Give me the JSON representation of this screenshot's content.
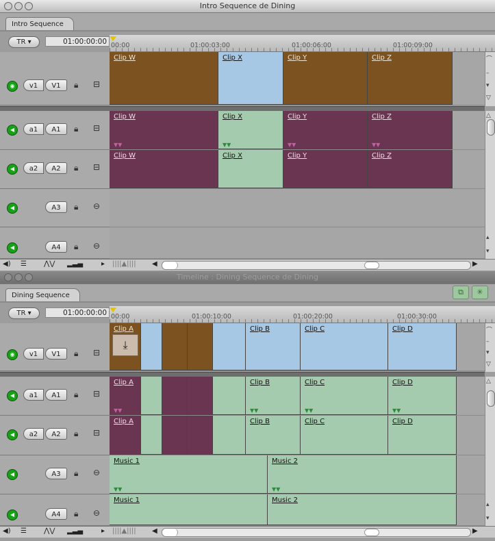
{
  "windows": [
    {
      "title": "Intro Sequence de Dining",
      "tab": "Intro Sequence",
      "track_button": "TR",
      "timecode": "01:00:00:00",
      "ruler_marks": [
        "00:00",
        "01:00:03:00",
        "01:00:06:00",
        "01:00:09:00"
      ],
      "tracks": {
        "v1": {
          "src": "v1",
          "dst": "V1",
          "clips": [
            "Clip W",
            "Clip X",
            "Clip Y",
            "Clip Z"
          ]
        },
        "a1": {
          "src": "a1",
          "dst": "A1",
          "clips": [
            "Clip W",
            "Clip X",
            "Clip Y",
            "Clip Z"
          ]
        },
        "a2": {
          "src": "a2",
          "dst": "A2",
          "clips": [
            "Clip W",
            "Clip X",
            "Clip Y",
            "Clip Z"
          ]
        },
        "a3": {
          "dst": "A3"
        },
        "a4": {
          "dst": "A4"
        }
      }
    },
    {
      "title": "Timeline : Dining Sequence de Dining",
      "tab": "Dining Sequence",
      "track_button": "TR",
      "timecode": "01:00:00:00",
      "ruler_marks": [
        "00:00",
        "01:00:10:00",
        "01:00:20:00",
        "01:00:30:00"
      ],
      "tracks": {
        "v1": {
          "src": "v1",
          "dst": "V1",
          "clips": [
            "Clip A",
            "Clip B",
            "Clip C",
            "Clip D"
          ]
        },
        "a1": {
          "src": "a1",
          "dst": "A1",
          "clips": [
            "Clip A",
            "Clip B",
            "Clip C",
            "Clip D"
          ]
        },
        "a2": {
          "src": "a2",
          "dst": "A2",
          "clips": [
            "Clip A",
            "Clip B",
            "Clip C",
            "Clip D"
          ]
        },
        "a3": {
          "dst": "A3",
          "clips": [
            "Music 1",
            "Music 2"
          ]
        },
        "a4": {
          "dst": "A4",
          "clips": [
            "Music 1",
            "Music 2"
          ]
        }
      }
    }
  ],
  "icons": {
    "speaker": "speaker-icon",
    "monitor": "eye-icon",
    "lock": "lock-icon",
    "auto_select": "auto-select-icon",
    "overwrite": "overwrite-down-arrow-icon",
    "snapping": "snapping-icon",
    "linking": "linking-icon"
  },
  "colors": {
    "video_brown": "#7b5220",
    "video_blue": "#a7c8e4",
    "audio_purple": "#6a3550",
    "audio_green": "#a5cbae",
    "playhead": "#e8c400",
    "track_on": "#16a116"
  }
}
